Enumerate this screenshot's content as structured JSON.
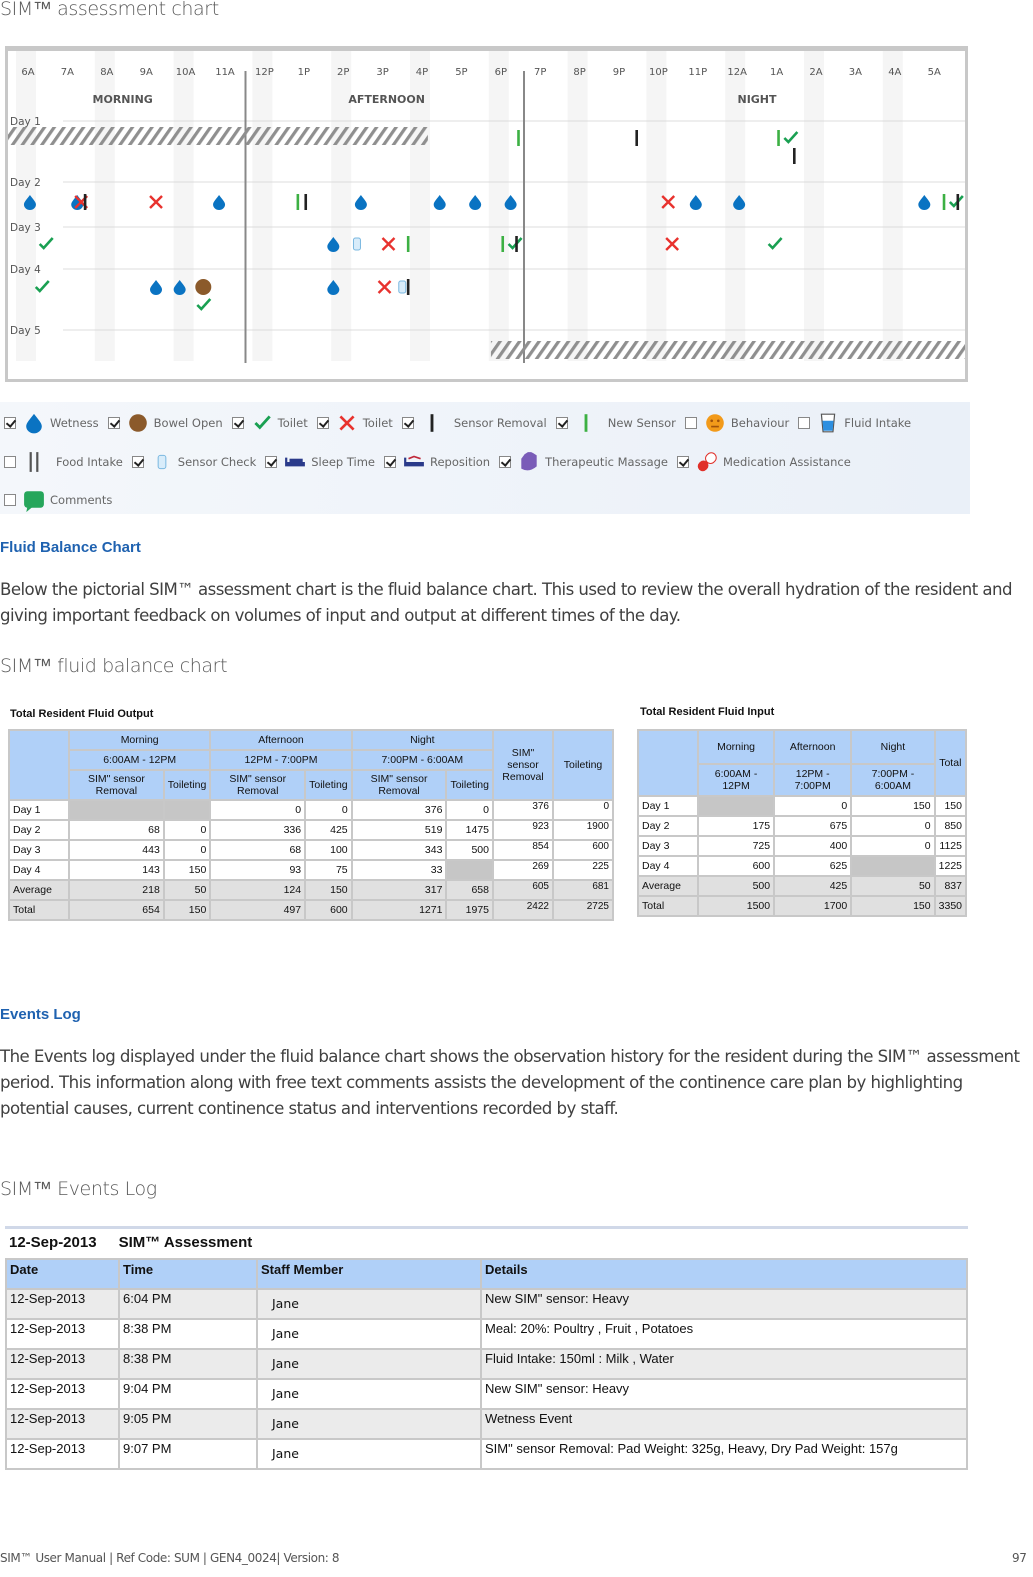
{
  "captions": {
    "assessment_chart": "SIM™ assessment chart",
    "fluid_balance_chart": "SIM™ fluid balance chart",
    "events_log": "SIM™ Events Log"
  },
  "sections": {
    "fluid_balance": {
      "heading": "Fluid Balance Chart",
      "body": "Below the pictorial SIM™ assessment chart is the fluid balance chart.  This used to review the overall hydration of the resident and giving important feedback on volumes of input and output at different times of the day."
    },
    "events_log": {
      "heading": "Events Log",
      "body": "The Events log displayed under the fluid balance chart shows the observation history for the resident during the SIM™ assessment period. This information along with free text comments assists the development of the continence care plan by highlighting potential causes, current continence status and interventions recorded by staff."
    }
  },
  "assessment_chart": {
    "hours": [
      "6A",
      "7A",
      "8A",
      "9A",
      "10A",
      "11A",
      "12P",
      "1P",
      "2P",
      "3P",
      "4P",
      "5P",
      "6P",
      "7P",
      "8P",
      "9P",
      "10P",
      "11P",
      "12A",
      "1A",
      "2A",
      "3A",
      "4A",
      "5A"
    ],
    "periods": [
      "MORNING",
      "AFTERNOON",
      "NIGHT"
    ],
    "days": [
      "Day 1",
      "Day 2",
      "Day 3",
      "Day 4",
      "Day 5"
    ],
    "events": [
      {
        "day": 1,
        "hour": 12.5,
        "type": "new-sensor"
      },
      {
        "day": 1,
        "hour": 15.5,
        "type": "sensor-removal"
      },
      {
        "day": 1,
        "hour": 19.1,
        "type": "new-sensor"
      },
      {
        "day": 1,
        "hour": 19.4,
        "type": "toilet-yes"
      },
      {
        "day": 1,
        "hour": 19.5,
        "type": "sensor-removal",
        "offset": 1
      },
      {
        "day": 2,
        "hour": 0.1,
        "type": "wetness"
      },
      {
        "day": 2,
        "hour": 1.3,
        "type": "wetness"
      },
      {
        "day": 2,
        "hour": 1.4,
        "type": "toilet-no"
      },
      {
        "day": 2,
        "hour": 1.5,
        "type": "sensor-removal"
      },
      {
        "day": 2,
        "hour": 3.3,
        "type": "toilet-no"
      },
      {
        "day": 2,
        "hour": 4.9,
        "type": "wetness"
      },
      {
        "day": 2,
        "hour": 6.9,
        "type": "new-sensor"
      },
      {
        "day": 2,
        "hour": 7.1,
        "type": "sensor-removal"
      },
      {
        "day": 2,
        "hour": 8.5,
        "type": "wetness"
      },
      {
        "day": 2,
        "hour": 10.5,
        "type": "wetness"
      },
      {
        "day": 2,
        "hour": 11.4,
        "type": "wetness"
      },
      {
        "day": 2,
        "hour": 12.3,
        "type": "wetness"
      },
      {
        "day": 2,
        "hour": 16.3,
        "type": "toilet-no"
      },
      {
        "day": 2,
        "hour": 17.0,
        "type": "wetness"
      },
      {
        "day": 2,
        "hour": 18.1,
        "type": "wetness"
      },
      {
        "day": 2,
        "hour": 22.8,
        "type": "wetness"
      },
      {
        "day": 2,
        "hour": 23.3,
        "type": "new-sensor"
      },
      {
        "day": 2,
        "hour": 23.6,
        "type": "toilet-yes"
      },
      {
        "day": 2,
        "hour": 23.65,
        "type": "sensor-removal"
      },
      {
        "day": 3,
        "hour": 0.5,
        "type": "toilet-yes"
      },
      {
        "day": 3,
        "hour": 7.8,
        "type": "wetness"
      },
      {
        "day": 3,
        "hour": 8.4,
        "type": "sensor-check"
      },
      {
        "day": 3,
        "hour": 9.2,
        "type": "toilet-no"
      },
      {
        "day": 3,
        "hour": 9.7,
        "type": "new-sensor"
      },
      {
        "day": 3,
        "hour": 12.1,
        "type": "new-sensor"
      },
      {
        "day": 3,
        "hour": 12.4,
        "type": "toilet-yes"
      },
      {
        "day": 3,
        "hour": 12.45,
        "type": "sensor-removal"
      },
      {
        "day": 3,
        "hour": 16.4,
        "type": "toilet-no"
      },
      {
        "day": 3,
        "hour": 19.0,
        "type": "toilet-yes"
      },
      {
        "day": 4,
        "hour": 0.4,
        "type": "toilet-yes"
      },
      {
        "day": 4,
        "hour": 3.3,
        "type": "wetness"
      },
      {
        "day": 4,
        "hour": 3.9,
        "type": "wetness"
      },
      {
        "day": 4,
        "hour": 4.5,
        "type": "bowel-open"
      },
      {
        "day": 4,
        "hour": 4.5,
        "type": "toilet-yes",
        "offset": 1
      },
      {
        "day": 4,
        "hour": 7.8,
        "type": "wetness"
      },
      {
        "day": 4,
        "hour": 9.1,
        "type": "toilet-no"
      },
      {
        "day": 4,
        "hour": 9.55,
        "type": "sensor-check"
      },
      {
        "day": 4,
        "hour": 9.7,
        "type": "sensor-removal"
      }
    ],
    "unavailable": [
      {
        "day": 1,
        "from_hour": 0,
        "to_hour": 10.2
      },
      {
        "day": 5,
        "from_hour": 11.8,
        "to_hour": 24
      }
    ]
  },
  "legend": {
    "rows": [
      [
        {
          "label": "Wetness",
          "icon": "wetness",
          "checked": true
        },
        {
          "label": "Bowel Open",
          "icon": "bowel-open",
          "checked": true
        },
        {
          "label": "Toilet",
          "icon": "toilet-yes",
          "checked": true
        },
        {
          "label": "Toilet",
          "icon": "toilet-no",
          "checked": true
        },
        {
          "label": "Sensor Removal",
          "icon": "sensor-removal",
          "checked": true
        },
        {
          "label": "New Sensor",
          "icon": "new-sensor",
          "checked": true
        },
        {
          "label": "Behaviour",
          "icon": "behaviour",
          "checked": false
        },
        {
          "label": "Fluid Intake",
          "icon": "fluid-intake",
          "checked": false
        }
      ],
      [
        {
          "label": "Food Intake",
          "icon": "food-intake",
          "checked": false
        },
        {
          "label": "Sensor Check",
          "icon": "sensor-check",
          "checked": true
        },
        {
          "label": "Sleep Time",
          "icon": "sleep-time",
          "checked": true
        },
        {
          "label": "Reposition",
          "icon": "reposition",
          "checked": true
        },
        {
          "label": "Therapeutic Massage",
          "icon": "therapeutic-massage",
          "checked": true
        },
        {
          "label": "Medication Assistance",
          "icon": "medication-assistance",
          "checked": true
        }
      ],
      [
        {
          "label": "Comments",
          "icon": "comments",
          "checked": false
        }
      ]
    ]
  },
  "fluid_output": {
    "title": "Total Resident Fluid Output",
    "periods": [
      {
        "name": "Morning",
        "range": "6:00AM - 12PM"
      },
      {
        "name": "Afternoon",
        "range": "12PM - 7:00PM"
      },
      {
        "name": "Night",
        "range": "7:00PM - 6:00AM"
      }
    ],
    "sub_headers": [
      "SIM\" sensor Removal",
      "Toileting"
    ],
    "total_headers": [
      "SIM\" sensor Removal",
      "Toileting"
    ],
    "rows": [
      {
        "label": "Day 1",
        "values": [
          "",
          "",
          "0",
          "0",
          "376",
          "0"
        ],
        "totals": [
          "376",
          "0"
        ]
      },
      {
        "label": "Day 2",
        "values": [
          "68",
          "0",
          "336",
          "425",
          "519",
          "1475"
        ],
        "totals": [
          "923",
          "1900"
        ]
      },
      {
        "label": "Day 3",
        "values": [
          "443",
          "0",
          "68",
          "100",
          "343",
          "500"
        ],
        "totals": [
          "854",
          "600"
        ]
      },
      {
        "label": "Day 4",
        "values": [
          "143",
          "150",
          "93",
          "75",
          "33",
          ""
        ],
        "totals": [
          "269",
          "225"
        ]
      },
      {
        "label": "Average",
        "values": [
          "218",
          "50",
          "124",
          "150",
          "317",
          "658"
        ],
        "totals": [
          "605",
          "681"
        ]
      },
      {
        "label": "Total",
        "values": [
          "654",
          "150",
          "497",
          "600",
          "1271",
          "1975"
        ],
        "totals": [
          "2422",
          "2725"
        ]
      }
    ]
  },
  "fluid_input": {
    "title": "Total Resident Fluid Input",
    "periods": [
      {
        "name": "Morning",
        "range": "6:00AM - 12PM"
      },
      {
        "name": "Afternoon",
        "range": "12PM - 7:00PM"
      },
      {
        "name": "Night",
        "range": "7:00PM - 6:00AM"
      }
    ],
    "total_header": "Total",
    "rows": [
      {
        "label": "Day 1",
        "values": [
          "",
          "0",
          "150",
          "150"
        ]
      },
      {
        "label": "Day 2",
        "values": [
          "175",
          "675",
          "0",
          "850"
        ]
      },
      {
        "label": "Day 3",
        "values": [
          "725",
          "400",
          "0",
          "1125"
        ]
      },
      {
        "label": "Day 4",
        "values": [
          "600",
          "625",
          "",
          "1225"
        ]
      },
      {
        "label": "Average",
        "values": [
          "500",
          "425",
          "50",
          "837"
        ]
      },
      {
        "label": "Total",
        "values": [
          "1500",
          "1700",
          "150",
          "3350"
        ]
      }
    ]
  },
  "events_log": {
    "date": "12-Sep-2013",
    "title": "SIM™ Assessment",
    "columns": [
      "Date",
      "Time",
      "Staff Member",
      "Details"
    ],
    "rows": [
      [
        "12-Sep-2013",
        "6:04 PM",
        "Jane",
        "New SIM\" sensor: Heavy"
      ],
      [
        "12-Sep-2013",
        "8:38 PM",
        "Jane",
        "Meal: 20%:  Poultry , Fruit , Potatoes"
      ],
      [
        "12-Sep-2013",
        "8:38 PM",
        "Jane",
        "Fluid Intake: 150ml :  Milk , Water"
      ],
      [
        "12-Sep-2013",
        "9:04 PM",
        "Jane",
        "New SIM\" sensor: Heavy"
      ],
      [
        "12-Sep-2013",
        "9:05 PM",
        "Jane",
        "Wetness Event"
      ],
      [
        "12-Sep-2013",
        "9:07 PM",
        "Jane",
        "SIM\" sensor Removal: Pad Weight: 325g, Heavy, Dry Pad Weight: 157g"
      ]
    ]
  },
  "footer": {
    "left": "SIM™ User Manual | Ref Code: SUM | GEN4_0024| Version: 8",
    "page": "97"
  },
  "colors": {
    "heading": "#1f62b0",
    "table_header": "#b0d0f8",
    "wetness": "#0a73c2",
    "bowel": "#8b5a2b",
    "toilet_yes": "#1aa052",
    "toilet_no": "#e8322e",
    "new_sensor": "#3cb043"
  }
}
